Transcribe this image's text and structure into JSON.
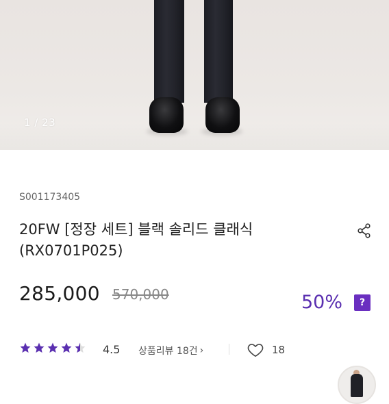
{
  "gallery": {
    "counter": "1 / 23"
  },
  "product": {
    "code": "S001173405",
    "title_line1": "20FW [정장 세트] 블랙 솔리드 클래식",
    "title_line2": "(RX0701P025)",
    "price": "285,000",
    "original_price": "570,000",
    "discount": "50%",
    "discount_help": "?"
  },
  "rating": {
    "score": "4.5",
    "stars": 4.5,
    "review_label": "상품리뷰 18건",
    "review_arrow": "›"
  },
  "like": {
    "count": "18",
    "icon": "heart-outline-icon"
  },
  "colors": {
    "star": "#5a2fb0",
    "discount": "#5a2fb0",
    "help_badge": "#6a2fc0"
  }
}
